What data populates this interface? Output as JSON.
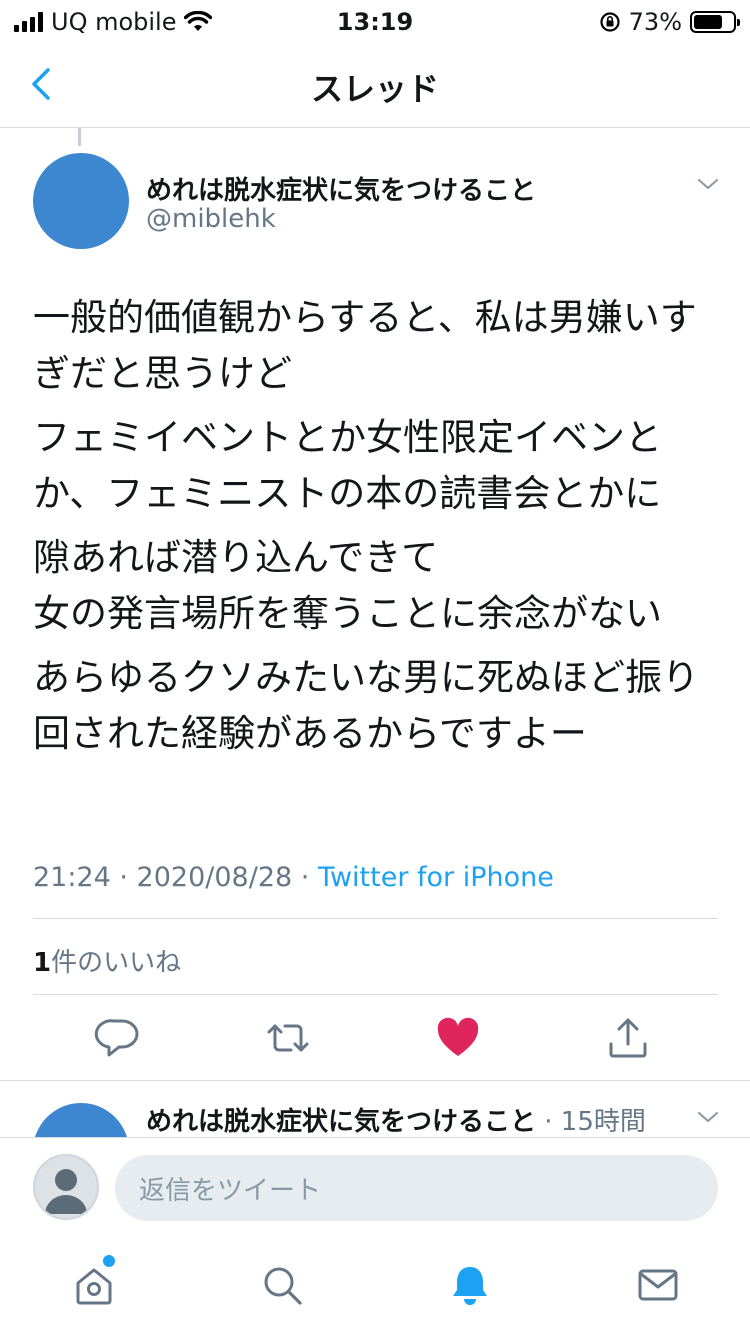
{
  "status_bar": {
    "carrier": "UQ mobile",
    "time": "13:19",
    "battery_percent": "73%",
    "battery_level": 0.73
  },
  "nav": {
    "title": "スレッド",
    "back_icon": "chevron-left-icon"
  },
  "tweet": {
    "author_name": "めれは脱水症状に気をつけること",
    "author_handle": "@miblehk",
    "paragraphs": [
      "一般的価値観からすると、私は男嫌いすぎだと思うけど",
      "フェミイベントとか女性限定イベンとか、フェミニストの本の読書会とかに",
      "隙あれば潜り込んできて\n女の発言場所を奪うことに余念がない",
      "あらゆるクソみたいな男に死ぬほど振り回された経験があるからですよー"
    ],
    "timestamp": "21:24 · 2020/08/28 · ",
    "source": "Twitter for iPhone",
    "like_count": "1",
    "like_label": "件のいいね",
    "liked": true
  },
  "reply_preview": {
    "author_name": "めれは脱水症状に気をつけること",
    "time": " · 15時間"
  },
  "reply_bar": {
    "placeholder": "返信をツイート"
  },
  "tabs": [
    "home-icon",
    "search-icon",
    "notifications-icon",
    "messages-icon"
  ],
  "colors": {
    "accent": "#1da1f2",
    "like": "#e0245e",
    "avatar": "#3d87d0",
    "muted": "#657786"
  }
}
